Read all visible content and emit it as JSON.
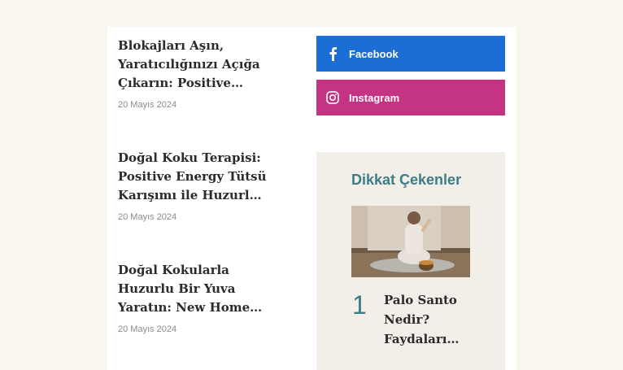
{
  "posts": [
    {
      "title": "Blokajları Aşın, Yaratıcılığınızı Açığa Çıkarın: Positive Energy Tütsüsü",
      "date": "20 Mayıs 2024"
    },
    {
      "title": "Doğal Koku Terapisi: Positive Energy Tütsü Karışımı ile Huzurlu Bir Ortam",
      "date": "20 Mayıs 2024"
    },
    {
      "title": "Doğal Kokularla Huzurlu Bir Yuva Yaratın: New Home Tütsüsü ile…",
      "date": "20 Mayıs 2024"
    }
  ],
  "social": {
    "facebook_label": "Facebook",
    "instagram_label": "Instagram"
  },
  "featured": {
    "heading": "Dikkat Çekenler",
    "items": [
      {
        "rank": "1",
        "title": "Palo Santo Nedir? Faydaları…"
      }
    ]
  },
  "colors": {
    "facebook": "#1b6ed6",
    "instagram": "#c53483",
    "accent": "#3e7c86"
  },
  "icons": {
    "facebook": "facebook-icon",
    "instagram": "instagram-icon"
  }
}
